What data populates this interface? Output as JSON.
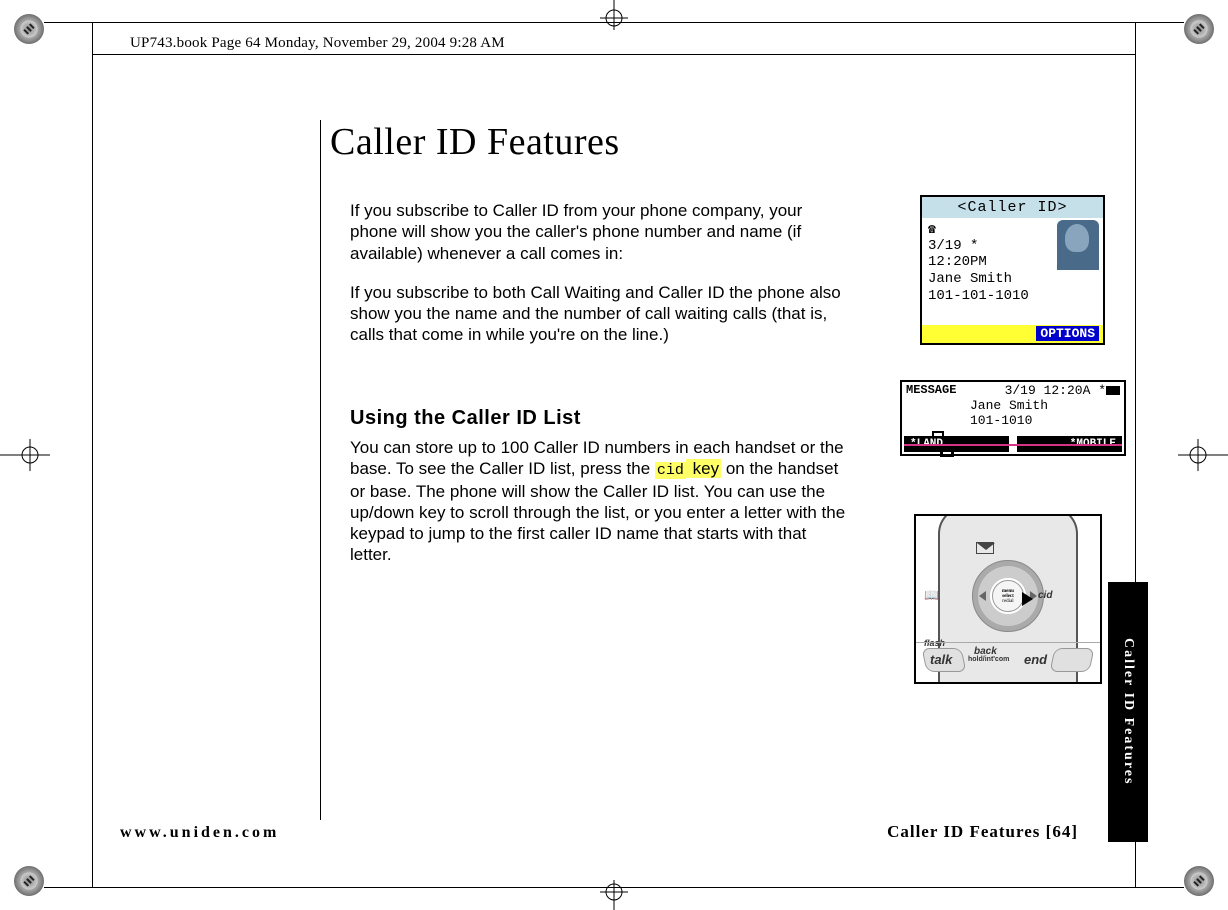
{
  "meta": {
    "book_header": "UP743.book  Page 64  Monday, November 29, 2004  9:28 AM"
  },
  "page": {
    "title": "Caller ID Features",
    "para1": "If you subscribe to Caller ID from your phone company, your phone will show you the caller's phone number and name (if available) whenever a call comes in:",
    "para2": "If you subscribe to both Call Waiting and Caller ID the phone also show you the name and the number of call waiting calls (that is, calls that come in while you're on the line.)",
    "h2": "Using the Caller ID List",
    "para3a": "You can store up to 100 Caller ID numbers in each handset or the base. To see the Caller ID list, press the ",
    "cid_key": "cid",
    "key_word": " key",
    "para3b": " on the handset or base. The phone will show the Caller ID list. You can use the up/down key to scroll through the list, or you enter a letter with the keypad to jump to the first caller ID name that starts with that letter."
  },
  "screen1": {
    "title": "<Caller ID>",
    "phone_icon": "☎",
    "date": " 3/19 *",
    "time": "12:20PM",
    "name": "Jane Smith",
    "number": "101-101-1010",
    "options": "OPTIONS"
  },
  "screen2": {
    "message_label": "MESSAGE",
    "datetime": "3/19 12:20A *",
    "name": "Jane Smith",
    "number": "101-1010",
    "left_soft": "*LAND",
    "right_soft": "*MOBILE"
  },
  "phone_keys": {
    "menu": "menu",
    "select": "select",
    "redial": "redial",
    "cid": "cid",
    "flash": "flash",
    "talk": "talk",
    "back": "back",
    "hold": "hold/int'com",
    "end": "end"
  },
  "footer": {
    "left": "www.uniden.com",
    "right_label": "Caller ID Features",
    "right_page": "[64]",
    "side_tab": "Caller ID Features"
  }
}
